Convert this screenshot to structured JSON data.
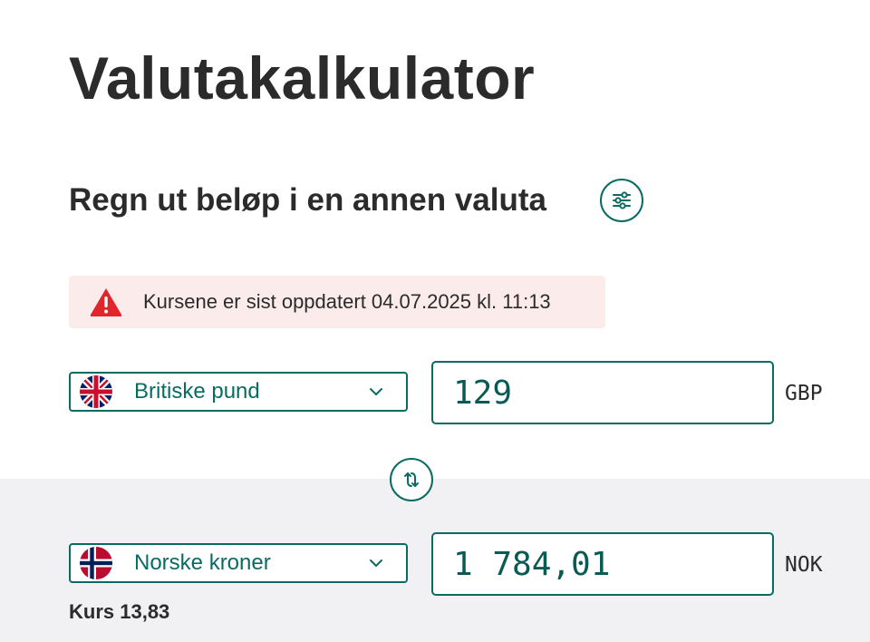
{
  "page": {
    "title": "Valutakalkulator",
    "subtitle": "Regn ut beløp i en annen valuta"
  },
  "alert": {
    "text": "Kursene er sist oppdatert 04.07.2025 kl. 11:13",
    "icon": "warning-icon",
    "color": "#e0262b"
  },
  "from": {
    "currency_label": "Britiske pund",
    "flag": "uk-flag-icon",
    "amount": "129",
    "code": "GBP"
  },
  "to": {
    "currency_label": "Norske kroner",
    "flag": "norway-flag-icon",
    "amount": "1 784,01",
    "code": "NOK"
  },
  "rate": {
    "text": "Kurs 13,83"
  },
  "colors": {
    "accent": "#0a6b63",
    "alert_bg": "#fbeceb",
    "band_bg": "#f1f1f3",
    "text": "#2b2b2b"
  },
  "icons": {
    "settings": "sliders-icon",
    "swap": "swap-arrows-icon",
    "dropdown": "chevron-down-icon"
  }
}
